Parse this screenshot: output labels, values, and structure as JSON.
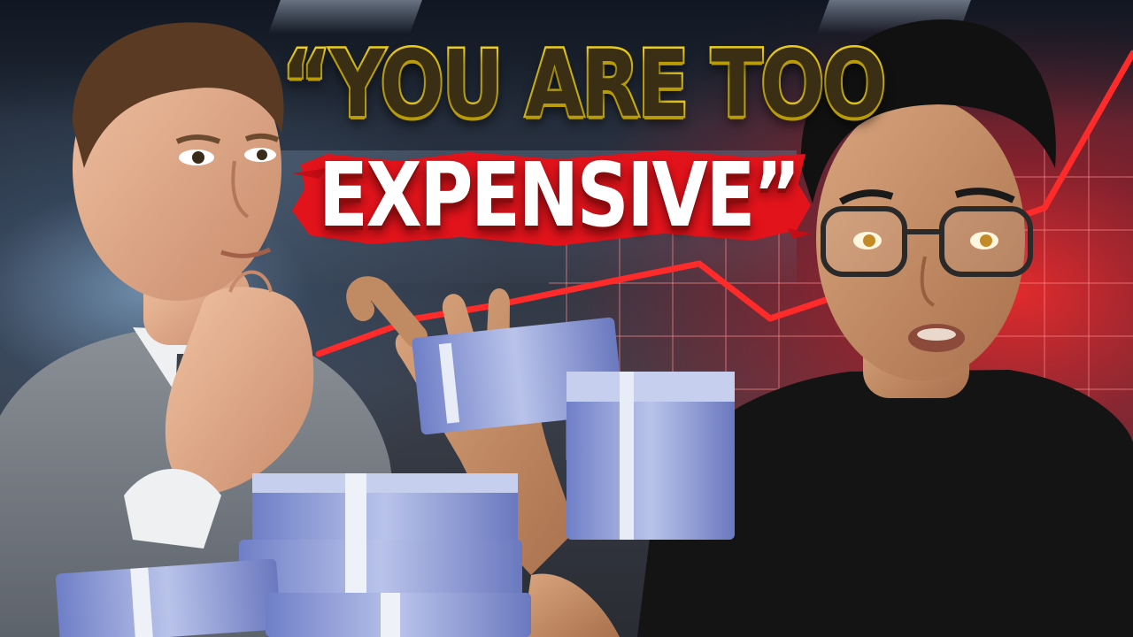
{
  "headline": {
    "line1": "“YOU ARE TOO",
    "line2": "EXPENSIVE”"
  },
  "colors": {
    "headline_yellow": "#f2d21b",
    "headline_dark": "#3a2e14",
    "brush_red": "#e3131b",
    "trend_red": "#ff2a2a",
    "headline_white": "#ffffff"
  },
  "icons": [
    "money-stack-icon",
    "trend-line-icon"
  ]
}
